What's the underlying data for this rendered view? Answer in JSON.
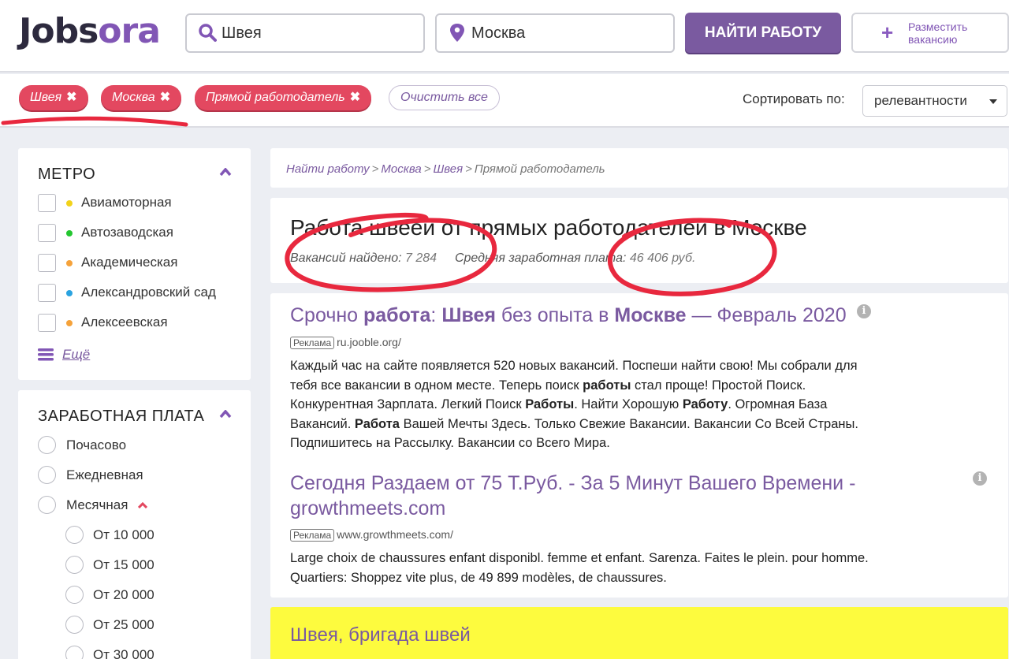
{
  "logo": {
    "part1": "Jobs",
    "part2": "ora"
  },
  "search": {
    "query": "Швея",
    "location": "Москва",
    "find_label": "НАЙТИ РАБОТУ",
    "post_label_1": "Разместить",
    "post_label_2": "вакансию"
  },
  "filters": {
    "chips": [
      "Швея",
      "Москва",
      "Прямой работодатель"
    ],
    "clear_label": "Очистить все",
    "sort_label": "Сортировать по:",
    "sort_value": "релевантности"
  },
  "sidebar": {
    "metro_title": "МЕТРО",
    "metro": [
      {
        "label": "Авиамоторная",
        "color": "#f2d21a"
      },
      {
        "label": "Автозаводская",
        "color": "#23c630"
      },
      {
        "label": "Академическая",
        "color": "#f5a23a"
      },
      {
        "label": "Александровский сад",
        "color": "#2aa3e0"
      },
      {
        "label": "Алексеевская",
        "color": "#f5a23a"
      }
    ],
    "more_label": "Ещё",
    "salary_title": "ЗАРАБОТНАЯ ПЛАТА",
    "salary": [
      "Почасово",
      "Ежедневная",
      "Месячная"
    ],
    "salary_sub": [
      "От 10 000",
      "От 15 000",
      "От 20 000",
      "От 25 000",
      "От 30 000"
    ]
  },
  "breadcrumbs": [
    "Найти работу",
    "Москва",
    "Швея",
    "Прямой работодатель"
  ],
  "header_card": {
    "title": "Работа швеей от прямых работодателей в Москве",
    "found_label": "Вакансий найдено:",
    "found_value": "7 284",
    "salary_label": "Средняя заработная плата:",
    "salary_value": "46 406 руб."
  },
  "ads": [
    {
      "title_parts": [
        "Срочно ",
        "работа",
        ": ",
        "Швея",
        " без опыта в ",
        "Москве",
        " — Февраль 2020"
      ],
      "badge": "Реклама",
      "url": "ru.jooble.org/",
      "text_parts": [
        "Каждый час на сайте появляется 520 новых вакансий. Поспеши найти свою! Мы собрали для тебя все вакансии в одном месте. Теперь поиск ",
        "работы",
        " стал проще! Простой Поиск. Конкурентная Зарплата. Легкий Поиск ",
        "Работы",
        ". Найти Хорошую ",
        "Работу",
        ". Огромная База Вакансий. ",
        "Работа",
        " Вашей Мечты Здесь. Только Свежие Вакансии. Вакансии Со Всей Страны. Подпишитесь на Рассылку. Вакансии со Всего Мира."
      ]
    },
    {
      "title": "Сегодня Раздаем от 75 Т.Руб. - За 5 Минут Вашего Времени - growthmeets.com",
      "badge": "Реклама",
      "url": "www.growthmeets.com/",
      "text": "Large choix de chaussures enfant disponibl. femme et enfant. Sarenza. Faites le plein. pour homme. Quartiers: Shoppez vite plus, de 49 899 modèles, de chaussures."
    }
  ],
  "featured": {
    "title": "Швея, бригада швей"
  },
  "colors": {
    "brand": "#7a5aa0",
    "chip": "#e34860",
    "highlight": "#fdfb3e",
    "annotation": "#e8283e"
  }
}
